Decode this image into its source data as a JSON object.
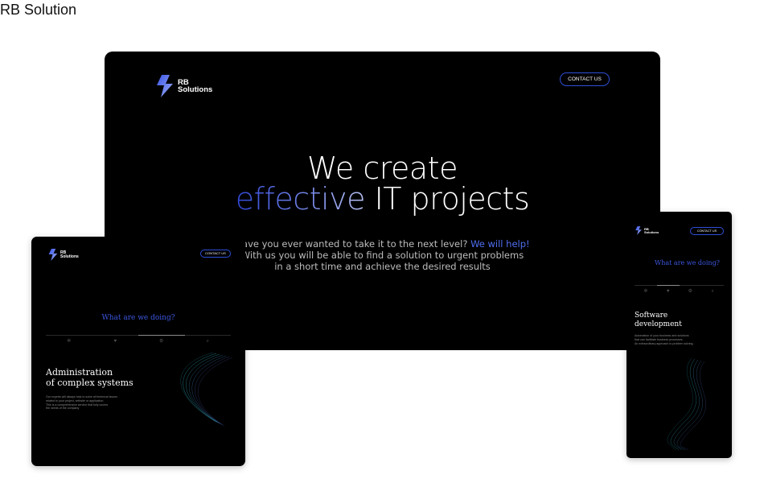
{
  "page_title": "RB Solution",
  "brand": {
    "name_line1": "RB",
    "name_line2": "Solutions"
  },
  "desktop": {
    "contact_label": "CONTACT US",
    "hero_line1": "We create",
    "hero_accent": "effective",
    "hero_line2_rest": " IT projects",
    "sub_line1_a": "Have you ever wanted to take it to the next level?",
    "sub_line1_b": "We will help!",
    "sub_line2": "With us you will be able to find a solution to urgent problems",
    "sub_line3": "in a short time and achieve the desired results"
  },
  "tablet": {
    "contact_label": "CONTACT US",
    "section_question": "What are we doing?",
    "service_title_1": "Administration",
    "service_title_2": "of complex systems",
    "desc_1": "Our experts will always help to solve all technical issues",
    "desc_2": "related to your project, website or application.",
    "desc_3": "This is a comprehensive service that fully covers",
    "desc_4": "the needs of the company"
  },
  "mobile": {
    "contact_label": "CONTACT US",
    "section_question": "What are we doing?",
    "service_title_1": "Software",
    "service_title_2": "development",
    "desc_1": "Automation of your business and solutions",
    "desc_2": "that can facilitate business processes.",
    "desc_3": "An extraordinary approach to problem solving."
  },
  "tabs": {
    "icons": [
      "cog-icon",
      "heart-icon",
      "gear-icon",
      "magnifier-icon"
    ],
    "tablet_active_index": 2,
    "mobile_active_index": 1
  },
  "colors": {
    "accent": "#2e4fd8",
    "background": "#000000",
    "text": "#ffffff"
  }
}
